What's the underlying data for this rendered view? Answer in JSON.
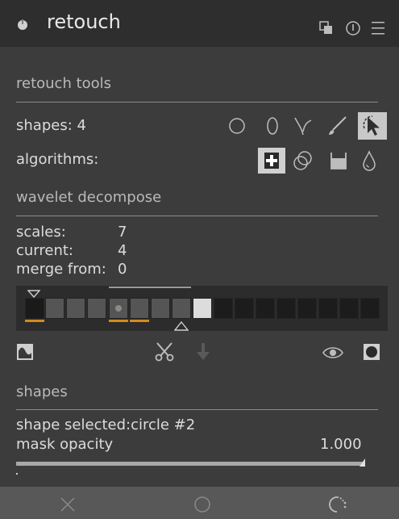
{
  "header": {
    "title": "retouch",
    "icons": [
      "power-icon",
      "presets-icon",
      "reset-icon",
      "menu-icon"
    ]
  },
  "sections": {
    "retouch_tools": "retouch tools",
    "wavelet_decompose": "wavelet decompose",
    "shapes": "shapes"
  },
  "retouch_tools": {
    "shapes_label": "shapes: 4",
    "algorithms_label": "algorithms:",
    "shape_icons": [
      "circle-shape-icon",
      "ellipse-shape-icon",
      "path-shape-icon",
      "brush-shape-icon",
      "show-hide-shapes-icon"
    ],
    "algorithm_icons": [
      "heal-icon",
      "clone-icon",
      "fill-icon",
      "blur-icon"
    ],
    "selected_algorithm": "heal"
  },
  "wavelet": {
    "scales_label": "scales:",
    "scales_value": "7",
    "current_label": "current:",
    "current_value": "4",
    "merge_label": "merge from:",
    "merge_value": "0",
    "tool_icons": [
      "display-wavelet-scale-icon",
      "cut-icon",
      "paste-icon",
      "display-masks-icon",
      "suppress-icon"
    ]
  },
  "shapes_section": {
    "selected_label": "shape selected:circle #2",
    "opacity_label": "mask opacity",
    "opacity_value": "1.000",
    "opacity_fraction": 1.0
  },
  "footer": {
    "icons": [
      "off-icon",
      "on-icon",
      "partial-icon"
    ]
  }
}
